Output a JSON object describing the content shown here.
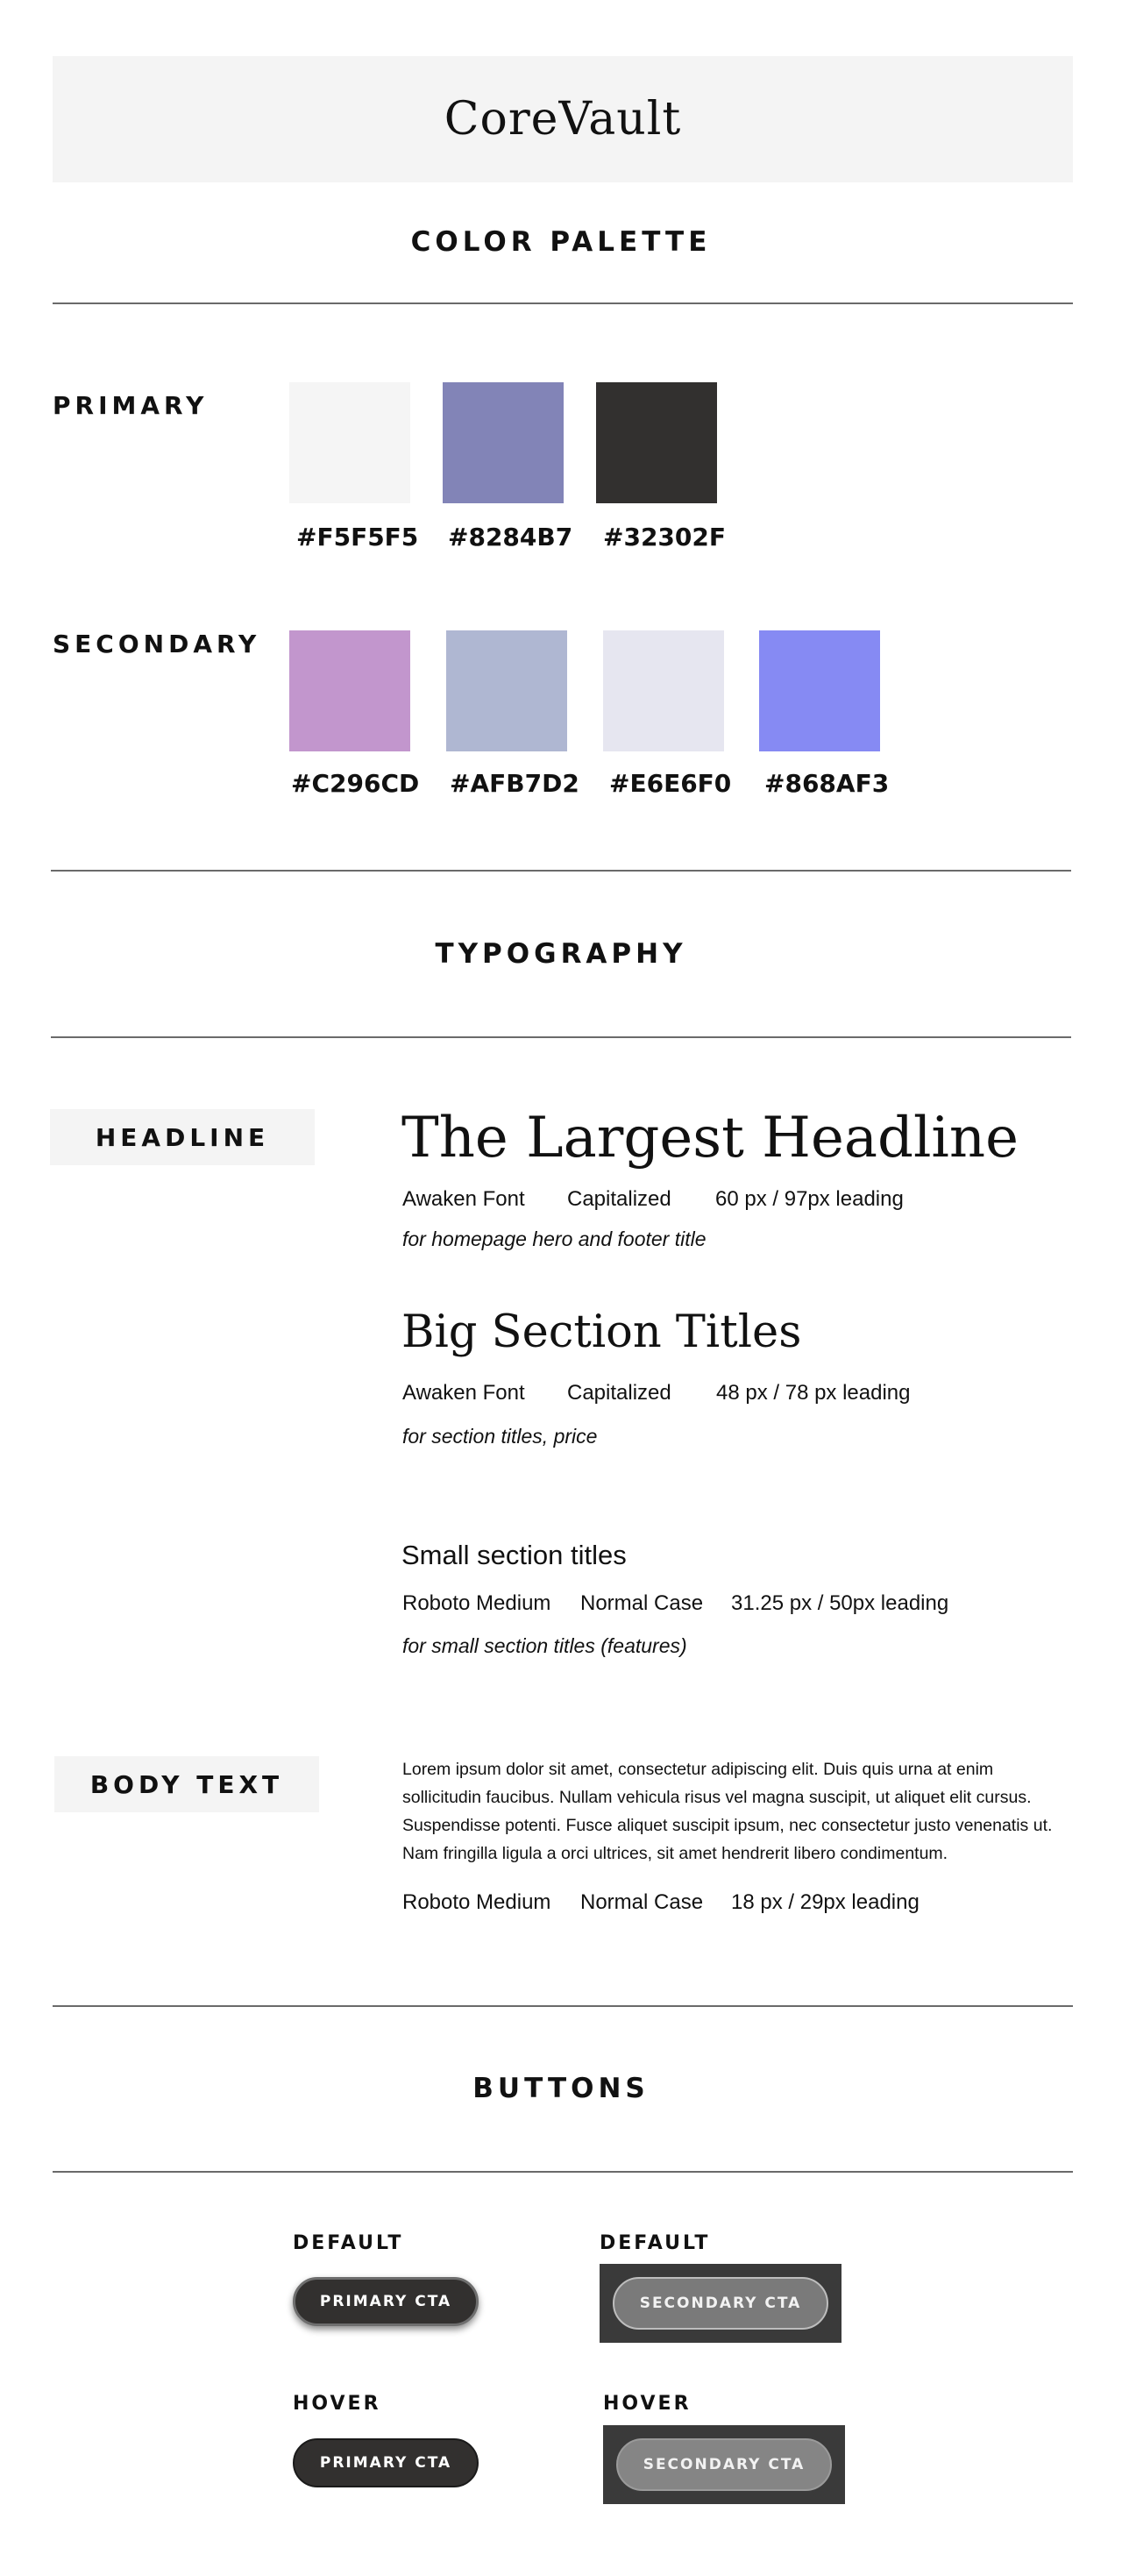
{
  "brand": {
    "logo": "CoreVault"
  },
  "colors": {
    "title": "COLOR PALETTE",
    "primary": {
      "label": "PRIMARY",
      "swatches": [
        {
          "hex": "#F5F5F5",
          "color": "#F5F5F5"
        },
        {
          "hex": "#8284B7",
          "color": "#8284B7"
        },
        {
          "hex": "#32302F",
          "color": "#32302F"
        }
      ]
    },
    "secondary": {
      "label": "SECONDARY",
      "swatches": [
        {
          "hex": "#C296CD",
          "color": "#C296CD"
        },
        {
          "hex": "#AFB7D2",
          "color": "#AFB7D2"
        },
        {
          "hex": "#E6E6F0",
          "color": "#E6E6F0"
        },
        {
          "hex": "#868AF3",
          "color": "#868AF3"
        }
      ]
    }
  },
  "typography": {
    "title": "TYPOGRAPHY",
    "headline_label": "HEADLINE",
    "styles": [
      {
        "sample": "The Largest Headline",
        "font": "Awaken Font",
        "case": "Capitalized",
        "size": "60 px / 97px leading",
        "usage": "for homepage hero and footer title"
      },
      {
        "sample": "Big Section Titles",
        "font": "Awaken Font",
        "case": "Capitalized",
        "size": "48 px / 78 px leading",
        "usage": "for section titles, price"
      },
      {
        "sample": "Small section titles",
        "font": "Roboto Medium",
        "case": "Normal Case",
        "size": "31.25 px / 50px leading",
        "usage": "for small section titles (features)"
      }
    ],
    "body_label": "BODY TEXT",
    "body_sample": "Lorem ipsum dolor sit amet, consectetur adipiscing elit. Duis quis urna at enim sollicitudin faucibus. Nullam vehicula risus vel magna suscipit, ut aliquet elit cursus. Suspendisse potenti. Fusce aliquet suscipit ipsum, nec consectetur justo venenatis ut. Nam fringilla ligula a orci ultrices, sit amet hendrerit libero condimentum.",
    "body_meta": {
      "font": "Roboto Medium",
      "case": "Normal Case",
      "size": "18 px / 29px leading"
    }
  },
  "buttons": {
    "title": "BUTTONS",
    "primary_default_label": "DEFAULT",
    "secondary_default_label": "DEFAULT",
    "primary_hover_label": "HOVER",
    "secondary_hover_label": "HOVER",
    "primary_text": "PRIMARY CTA",
    "secondary_text": "SECONDARY CTA"
  }
}
